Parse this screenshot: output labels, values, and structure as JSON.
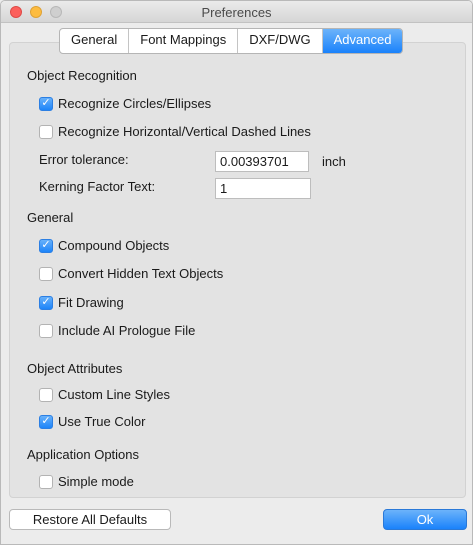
{
  "window": {
    "title": "Preferences"
  },
  "tabs": [
    {
      "label": "General",
      "active": false
    },
    {
      "label": "Font Mappings",
      "active": false
    },
    {
      "label": "DXF/DWG",
      "active": false
    },
    {
      "label": "Advanced",
      "active": true
    }
  ],
  "object_recognition": {
    "heading": "Object Recognition",
    "circles": {
      "label": "Recognize Circles/Ellipses",
      "checked": true
    },
    "dashed": {
      "label": "Recognize Horizontal/Vertical Dashed Lines",
      "checked": false
    },
    "error_tolerance": {
      "label": "Error tolerance:",
      "value": "0.00393701",
      "unit": "inch"
    },
    "kerning": {
      "label": "Kerning Factor Text:",
      "value": "1"
    }
  },
  "general": {
    "heading": "General",
    "compound": {
      "label": "Compound Objects",
      "checked": true
    },
    "hidden_text": {
      "label": "Convert Hidden Text Objects",
      "checked": false
    },
    "fit_drawing": {
      "label": "Fit Drawing",
      "checked": true
    },
    "ai_prologue": {
      "label": "Include AI Prologue File",
      "checked": false
    }
  },
  "object_attributes": {
    "heading": "Object Attributes",
    "line_styles": {
      "label": "Custom Line Styles",
      "checked": false
    },
    "true_color": {
      "label": "Use True Color",
      "checked": true
    }
  },
  "application_options": {
    "heading": "Application Options",
    "simple_mode": {
      "label": "Simple mode",
      "checked": false
    }
  },
  "buttons": {
    "restore": "Restore All Defaults",
    "ok": "Ok"
  },
  "colors": {
    "accent": "#1a82fb",
    "check": "#2c7fe3"
  }
}
